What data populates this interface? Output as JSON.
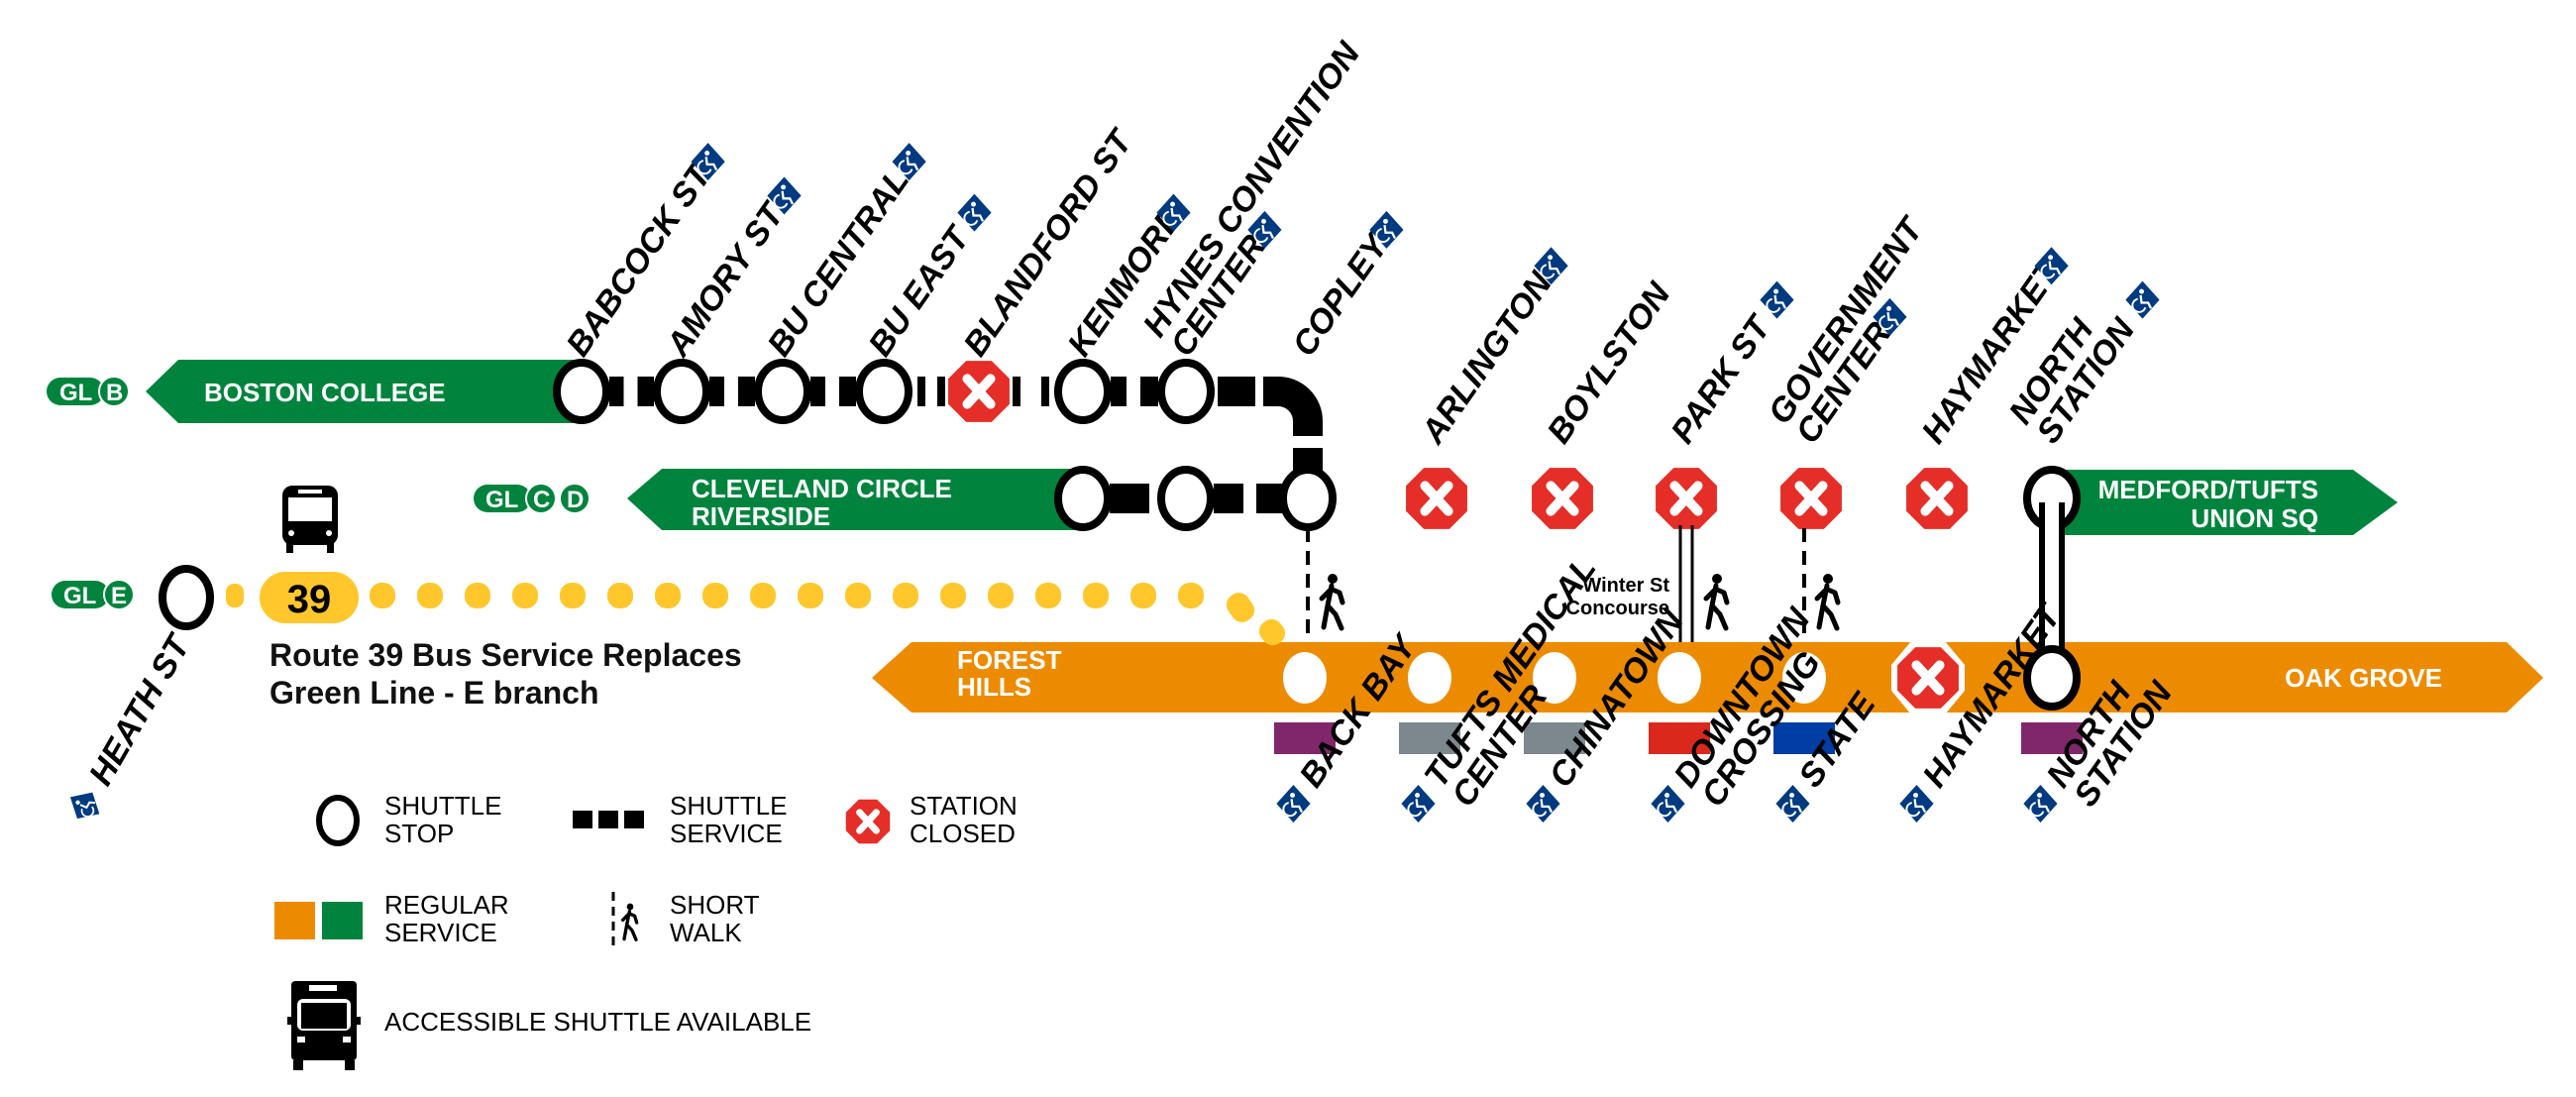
{
  "colors": {
    "green": "#00843D",
    "orange": "#ED8B00",
    "closed_red": "#E52E28",
    "accessible_blue": "#003A80",
    "yellow_bus": "#FFC72C",
    "silver": "#7C878E",
    "purple": "#80276C",
    "red_line": "#DA291C",
    "blue_line": "#003DA5"
  },
  "branches": {
    "gl_b": {
      "badge_line": "GL",
      "badge_branch": "B",
      "terminus": "BOSTON COLLEGE"
    },
    "gl_cd": {
      "badge_line": "GL",
      "badge_branches": [
        "C",
        "D"
      ],
      "terminus_line1": "CLEVELAND CIRCLE",
      "terminus_line2": "RIVERSIDE"
    },
    "gl_e": {
      "badge_line": "GL",
      "badge_branch": "E"
    },
    "medford": {
      "terminus_line1": "MEDFORD/TUFTS",
      "terminus_line2": "UNION SQ"
    },
    "orange": {
      "west_line1": "FOREST",
      "west_line2": "HILLS",
      "east": "OAK GROVE"
    }
  },
  "green_b_stations": [
    {
      "name": "BABCOCK ST",
      "status": "shuttle",
      "accessible": true
    },
    {
      "name": "AMORY ST",
      "status": "shuttle",
      "accessible": true
    },
    {
      "name": "BU CENTRAL",
      "status": "shuttle",
      "accessible": true
    },
    {
      "name": "BU EAST",
      "status": "shuttle",
      "accessible": true
    },
    {
      "name": "BLANDFORD ST",
      "status": "closed",
      "accessible": false
    },
    {
      "name": "KENMORE",
      "status": "shuttle",
      "accessible": true
    },
    {
      "name": "HYNES CONVENTION CENTER",
      "line1": "HYNES CONVENTION",
      "line2": "CENTER",
      "status": "shuttle",
      "accessible": true
    },
    {
      "name": "COPLEY",
      "status": "shuttle",
      "accessible": true
    }
  ],
  "green_trunk_stations": [
    {
      "name": "ARLINGTON",
      "status": "closed",
      "accessible": true
    },
    {
      "name": "BOYLSTON",
      "status": "closed",
      "accessible": false
    },
    {
      "name": "PARK ST",
      "status": "closed",
      "accessible": true
    },
    {
      "name": "GOVERNMENT CENTER",
      "line1": "GOVERNMENT",
      "line2": "CENTER",
      "status": "closed",
      "accessible": true
    },
    {
      "name": "HAYMARKET",
      "status": "closed",
      "accessible": true
    },
    {
      "name": "NORTH STATION",
      "line1": "NORTH",
      "line2": "STATION",
      "status": "regular",
      "accessible": true
    }
  ],
  "orange_stations": [
    {
      "name": "BACK BAY",
      "status": "regular",
      "accessible": true,
      "connection_color": "#80276C"
    },
    {
      "name": "TUFTS MEDICAL CENTER",
      "line1": "TUFTS MEDICAL",
      "line2": "CENTER",
      "status": "regular",
      "accessible": true,
      "connection_color": "#7C878E"
    },
    {
      "name": "CHINATOWN",
      "status": "regular",
      "accessible": true,
      "connection_color": "#7C878E"
    },
    {
      "name": "DOWNTOWN CROSSING",
      "line1": "DOWNTOWN",
      "line2": "CROSSING",
      "status": "regular",
      "accessible": true,
      "connection_color": "#DA291C"
    },
    {
      "name": "STATE",
      "status": "regular",
      "accessible": true,
      "connection_color": "#003DA5"
    },
    {
      "name": "HAYMARKET",
      "status": "closed",
      "accessible": true,
      "connection_color": null
    },
    {
      "name": "NORTH STATION",
      "line1": "NORTH",
      "line2": "STATION",
      "status": "regular",
      "accessible": true,
      "connection_color": "#80276C"
    }
  ],
  "heath_st": {
    "name": "HEATH ST",
    "accessible": true
  },
  "bus": {
    "route": "39",
    "note_line1": "Route 39 Bus Service Replaces",
    "note_line2": "Green Line - E branch"
  },
  "winter_st": {
    "line1": "Winter St",
    "line2": "Concourse"
  },
  "legend": {
    "shuttle_stop": [
      "SHUTTLE",
      "STOP"
    ],
    "shuttle_service": [
      "SHUTTLE",
      "SERVICE"
    ],
    "station_closed": [
      "STATION",
      "CLOSED"
    ],
    "regular_service": [
      "REGULAR",
      "SERVICE"
    ],
    "short_walk": [
      "SHORT",
      "WALK"
    ],
    "accessible_shuttle": "ACCESSIBLE SHUTTLE AVAILABLE"
  }
}
